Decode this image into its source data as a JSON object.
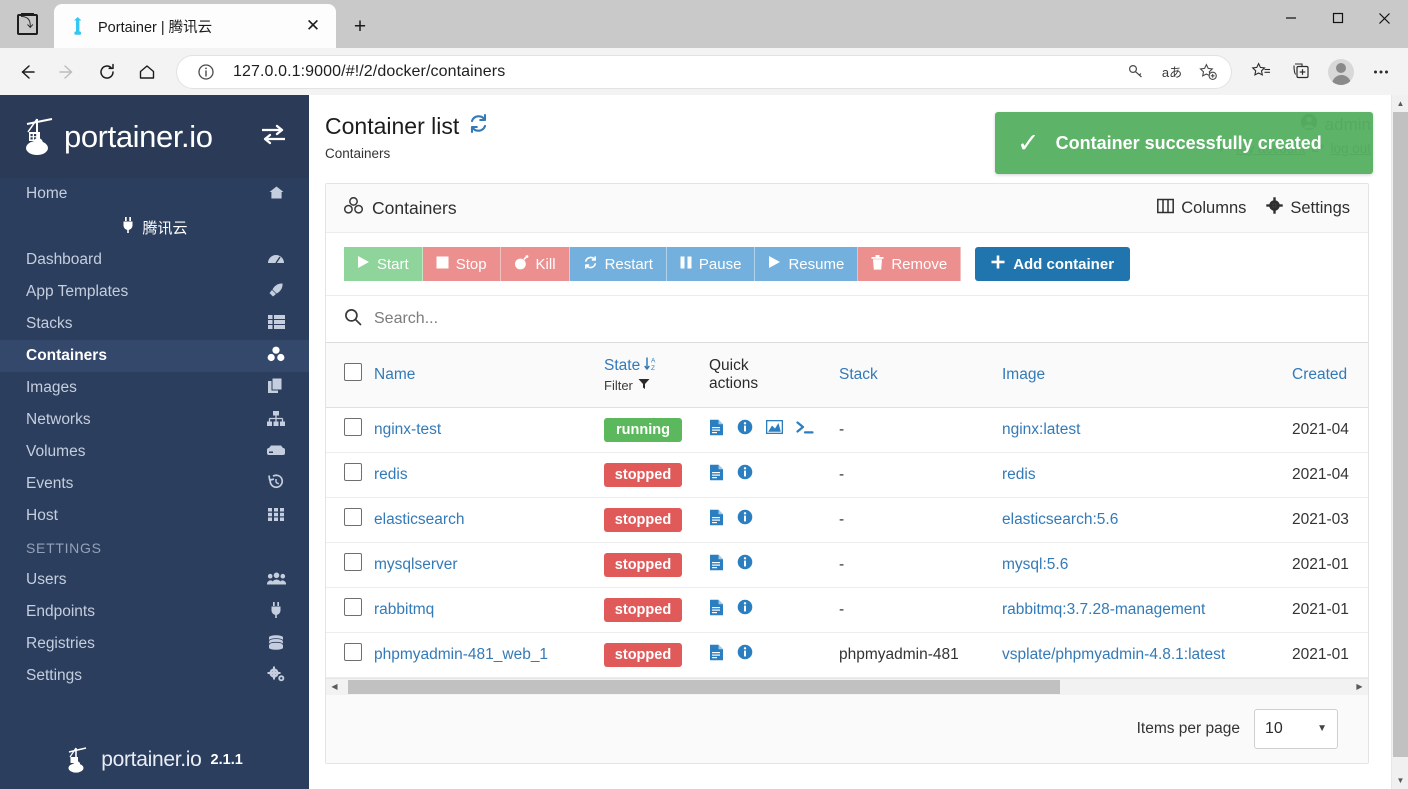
{
  "browser": {
    "tab": {
      "title": "Portainer | 腾讯云",
      "favicon_icon": "portainer-crane-icon",
      "close_icon": "close-icon"
    },
    "newtab_label": "+",
    "system_menu_icon": "browser-system-menu-icon",
    "nav": {
      "back_icon": "back-arrow-icon",
      "forward_icon": "forward-arrow-icon",
      "reload_icon": "reload-icon",
      "home_icon": "home-icon"
    },
    "omnibox": {
      "info_icon": "site-info-icon",
      "url_host": "127.0.0.1:9000",
      "url_path": "/#!/2/docker/containers",
      "url_full": "127.0.0.1:9000/#!/2/docker/containers",
      "key_icon": "password-key-icon",
      "translate_icon": "translate-icon",
      "favorite_icon": "add-favorite-star-icon"
    },
    "collections_icon": "favorites-list-icon",
    "tabs_aside_icon": "add-collection-icon",
    "profile_icon": "profile-avatar-icon",
    "more_icon": "more-settings-icon",
    "window": {
      "minimize": "—",
      "maximize": "◻",
      "close": "✕"
    }
  },
  "sidebar": {
    "brand": "portainer.io",
    "brand_logo_icon": "portainer-logo-icon",
    "toggle_icon": "collapse-sidebar-icon",
    "endpoint": {
      "label": "腾讯云",
      "icon": "plug-icon"
    },
    "items": [
      {
        "label": "Home",
        "icon": "home-icon",
        "active": false
      },
      {
        "label": "Dashboard",
        "icon": "dashboard-icon",
        "active": false
      },
      {
        "label": "App Templates",
        "icon": "rocket-icon",
        "active": false
      },
      {
        "label": "Stacks",
        "icon": "list-icon",
        "active": false
      },
      {
        "label": "Containers",
        "icon": "containers-icon",
        "active": true
      },
      {
        "label": "Images",
        "icon": "images-icon",
        "active": false
      },
      {
        "label": "Networks",
        "icon": "network-icon",
        "active": false
      },
      {
        "label": "Volumes",
        "icon": "volumes-icon",
        "active": false
      },
      {
        "label": "Events",
        "icon": "history-icon",
        "active": false
      },
      {
        "label": "Host",
        "icon": "grid-icon",
        "active": false
      }
    ],
    "section_label": "SETTINGS",
    "settings_items": [
      {
        "label": "Users",
        "icon": "users-icon"
      },
      {
        "label": "Endpoints",
        "icon": "plug-icon"
      },
      {
        "label": "Registries",
        "icon": "database-icon"
      },
      {
        "label": "Settings",
        "icon": "gears-icon"
      }
    ],
    "footer": {
      "brand": "portainer.io",
      "version": "2.1.1",
      "logo_icon": "portainer-logo-icon"
    }
  },
  "header": {
    "title": "Container list",
    "refresh_icon": "refresh-icon",
    "breadcrumb": "Containers",
    "user": {
      "name": "admin",
      "user_icon": "user-circle-icon",
      "my_account": "my account",
      "my_account_icon": "wrench-icon",
      "log_out": "log out",
      "log_out_icon": "sign-out-icon"
    }
  },
  "toast": {
    "message": "Container successfully created",
    "icon": "check-icon",
    "color": "#51ad5d"
  },
  "panel": {
    "title": "Containers",
    "title_icon": "containers-icon",
    "columns_label": "Columns",
    "columns_icon": "columns-icon",
    "settings_label": "Settings",
    "settings_icon": "gear-icon"
  },
  "actions": [
    {
      "label": "Start",
      "icon": "play-icon",
      "color": "green"
    },
    {
      "label": "Stop",
      "icon": "stop-square-icon",
      "color": "red"
    },
    {
      "label": "Kill",
      "icon": "bomb-icon",
      "color": "red"
    },
    {
      "label": "Restart",
      "icon": "restart-sync-icon",
      "color": "blue"
    },
    {
      "label": "Pause",
      "icon": "pause-icon",
      "color": "blue"
    },
    {
      "label": "Resume",
      "icon": "play-icon",
      "color": "blue"
    },
    {
      "label": "Remove",
      "icon": "trash-icon",
      "color": "red"
    }
  ],
  "add_container": {
    "label": "Add container",
    "icon": "plus-icon"
  },
  "search": {
    "placeholder": "Search...",
    "value": "",
    "icon": "search-icon"
  },
  "table": {
    "select_all_checkbox": "select-all-checkbox",
    "headers": {
      "name": "Name",
      "state": "State",
      "state_sort_icon": "sort-alpha-desc-icon",
      "filter_label": "Filter",
      "filter_icon": "filter-icon",
      "quick_actions_line1": "Quick",
      "quick_actions_line2": "actions",
      "stack": "Stack",
      "image": "Image",
      "created": "Created"
    },
    "rows": [
      {
        "name": "nginx-test",
        "state": "running",
        "quick_actions": [
          "logs-icon",
          "inspect-info-icon",
          "stats-chart-icon",
          "console-icon"
        ],
        "stack": "-",
        "image": "nginx:latest",
        "created": "2021-04"
      },
      {
        "name": "redis",
        "state": "stopped",
        "quick_actions": [
          "logs-icon",
          "inspect-info-icon"
        ],
        "stack": "-",
        "image": "redis",
        "created": "2021-04"
      },
      {
        "name": "elasticsearch",
        "state": "stopped",
        "quick_actions": [
          "logs-icon",
          "inspect-info-icon"
        ],
        "stack": "-",
        "image": "elasticsearch:5.6",
        "created": "2021-03"
      },
      {
        "name": "mysqlserver",
        "state": "stopped",
        "quick_actions": [
          "logs-icon",
          "inspect-info-icon"
        ],
        "stack": "-",
        "image": "mysql:5.6",
        "created": "2021-01"
      },
      {
        "name": "rabbitmq",
        "state": "stopped",
        "quick_actions": [
          "logs-icon",
          "inspect-info-icon"
        ],
        "stack": "-",
        "image": "rabbitmq:3.7.28-management",
        "created": "2021-01"
      },
      {
        "name": "phpmyadmin-481_web_1",
        "state": "stopped",
        "quick_actions": [
          "logs-icon",
          "inspect-info-icon"
        ],
        "stack": "phpmyadmin-481",
        "image": "vsplate/phpmyadmin-4.8.1:latest",
        "created": "2021-01"
      }
    ]
  },
  "pagination": {
    "label": "Items per page",
    "value": "10"
  },
  "colors": {
    "sidebar_bg": "#2c3e5d",
    "sidebar_active": "#33486b",
    "link": "#337ab7",
    "running": "#5cb85c",
    "stopped": "#e05a5a",
    "primary_button": "#2175ae",
    "toast": "#51ad5d"
  }
}
